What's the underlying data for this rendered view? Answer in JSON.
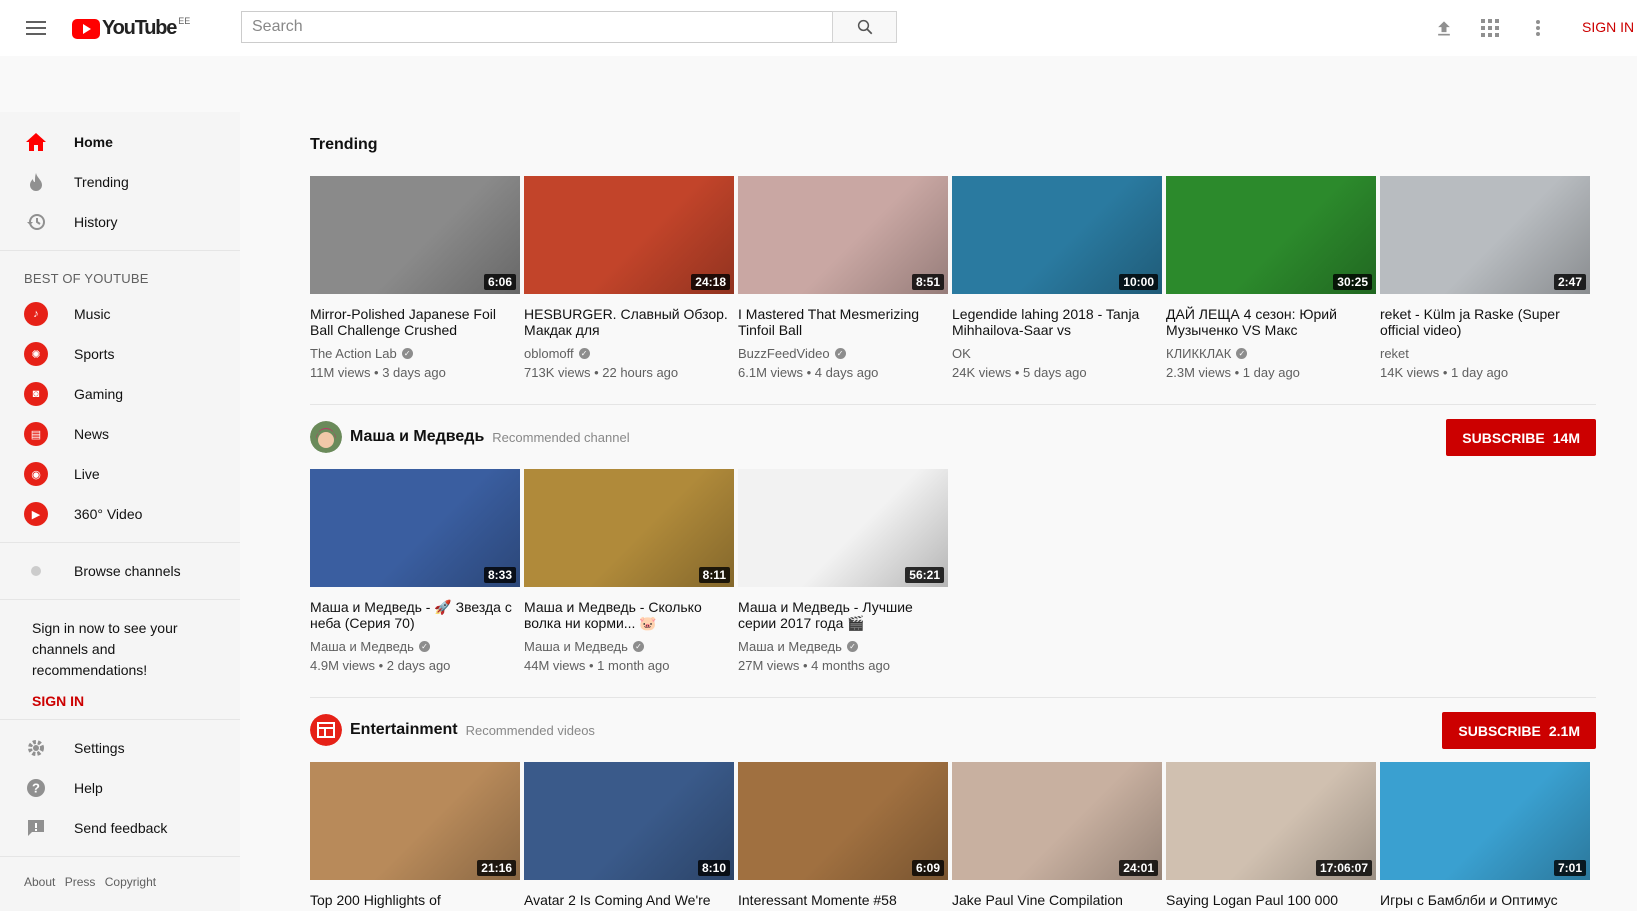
{
  "header": {
    "logo_text": "YouTube",
    "region": "EE",
    "search_placeholder": "Search",
    "signin": "SIGN IN"
  },
  "sidebar": {
    "nav": [
      {
        "label": "Home",
        "icon": "home-icon"
      },
      {
        "label": "Trending",
        "icon": "flame-icon"
      },
      {
        "label": "History",
        "icon": "history-icon"
      }
    ],
    "best_heading": "BEST OF YOUTUBE",
    "best": [
      {
        "label": "Music",
        "icon": "music-icon"
      },
      {
        "label": "Sports",
        "icon": "sports-icon"
      },
      {
        "label": "Gaming",
        "icon": "gaming-icon"
      },
      {
        "label": "News",
        "icon": "news-icon"
      },
      {
        "label": "Live",
        "icon": "live-icon"
      },
      {
        "label": "360° Video",
        "icon": "360-video-icon"
      }
    ],
    "browse": "Browse channels",
    "signin_text": "Sign in now to see your channels and recommendations!",
    "signin_link": "SIGN IN",
    "bottom": [
      {
        "label": "Settings",
        "icon": "gear-icon"
      },
      {
        "label": "Help",
        "icon": "help-icon"
      },
      {
        "label": "Send feedback",
        "icon": "feedback-icon"
      }
    ],
    "footer_links": [
      "About",
      "Press",
      "Copyright"
    ]
  },
  "trending": {
    "title": "Trending",
    "videos": [
      {
        "title": "Mirror-Polished Japanese Foil Ball Challenge Crushed",
        "channel": "The Action Lab",
        "meta": "11M views • 3 days ago",
        "duration": "6:06",
        "color": "#8a8a8a"
      },
      {
        "title": "HESBURGER. Славный Обзор. Макдак для",
        "channel": "oblomoff",
        "meta": "713K views • 22 hours ago",
        "duration": "24:18",
        "color": "#c2442a"
      },
      {
        "title": "I Mastered That Mesmerizing Tinfoil Ball",
        "channel": "BuzzFeedVideo",
        "meta": "6.1M views • 4 days ago",
        "duration": "8:51",
        "color": "#c9a7a3"
      },
      {
        "title": "Legendide lahing 2018 - Tanja Mihhailova-Saar vs",
        "channel": "OK",
        "meta": "24K views • 5 days ago",
        "duration": "10:00",
        "color": "#2a7aa0"
      },
      {
        "title": "ДАЙ ЛЕЩА 4 сезон: Юрий Музыченко VS Макс",
        "channel": "КЛИККЛАК",
        "meta": "2.3M views • 1 day ago",
        "duration": "30:25",
        "color": "#2c8a2c"
      },
      {
        "title": "reket - Külm ja Raske (Super official video)",
        "channel": "reket",
        "meta": "14K views • 1 day ago",
        "duration": "2:47",
        "color": "#b8bcc0"
      }
    ]
  },
  "shelf1": {
    "name": "Маша и Медведь",
    "sub": "Recommended channel",
    "subscribe": "SUBSCRIBE",
    "count": "14M",
    "videos": [
      {
        "title": "Маша и Медведь - 🚀 Звезда с неба (Серия 70)",
        "channel": "Маша и Медведь",
        "meta": "4.9M views • 2 days ago",
        "duration": "8:33",
        "color": "#3a5ea0"
      },
      {
        "title": "Маша и Медведь - Сколько волка ни корми... 🐷",
        "channel": "Маша и Медведь",
        "meta": "44M views • 1 month ago",
        "duration": "8:11",
        "color": "#b08a3a"
      },
      {
        "title": "Маша и Медведь - Лучшие серии 2017 года 🎬",
        "channel": "Маша и Медведь",
        "meta": "27M views • 4 months ago",
        "duration": "56:21",
        "color": "#f2f2f2"
      }
    ]
  },
  "shelf2": {
    "name": "Entertainment",
    "sub": "Recommended videos",
    "subscribe": "SUBSCRIBE",
    "count": "2.1M",
    "videos": [
      {
        "title": "Top 200 Highlights of",
        "duration": "21:16",
        "color": "#b88a5a"
      },
      {
        "title": "Avatar 2 Is Coming And We're",
        "duration": "8:10",
        "color": "#3a5a8a"
      },
      {
        "title": "Interessant Momente #58",
        "duration": "6:09",
        "color": "#a07040"
      },
      {
        "title": "Jake Paul Vine Compilation",
        "duration": "24:01",
        "color": "#c8b0a0"
      },
      {
        "title": "Saying Logan Paul 100 000",
        "duration": "17:06:07",
        "color": "#d0c0b0"
      },
      {
        "title": "Игры с Бамблби и Оптимус",
        "duration": "7:01",
        "color": "#3aa0d0"
      }
    ]
  }
}
